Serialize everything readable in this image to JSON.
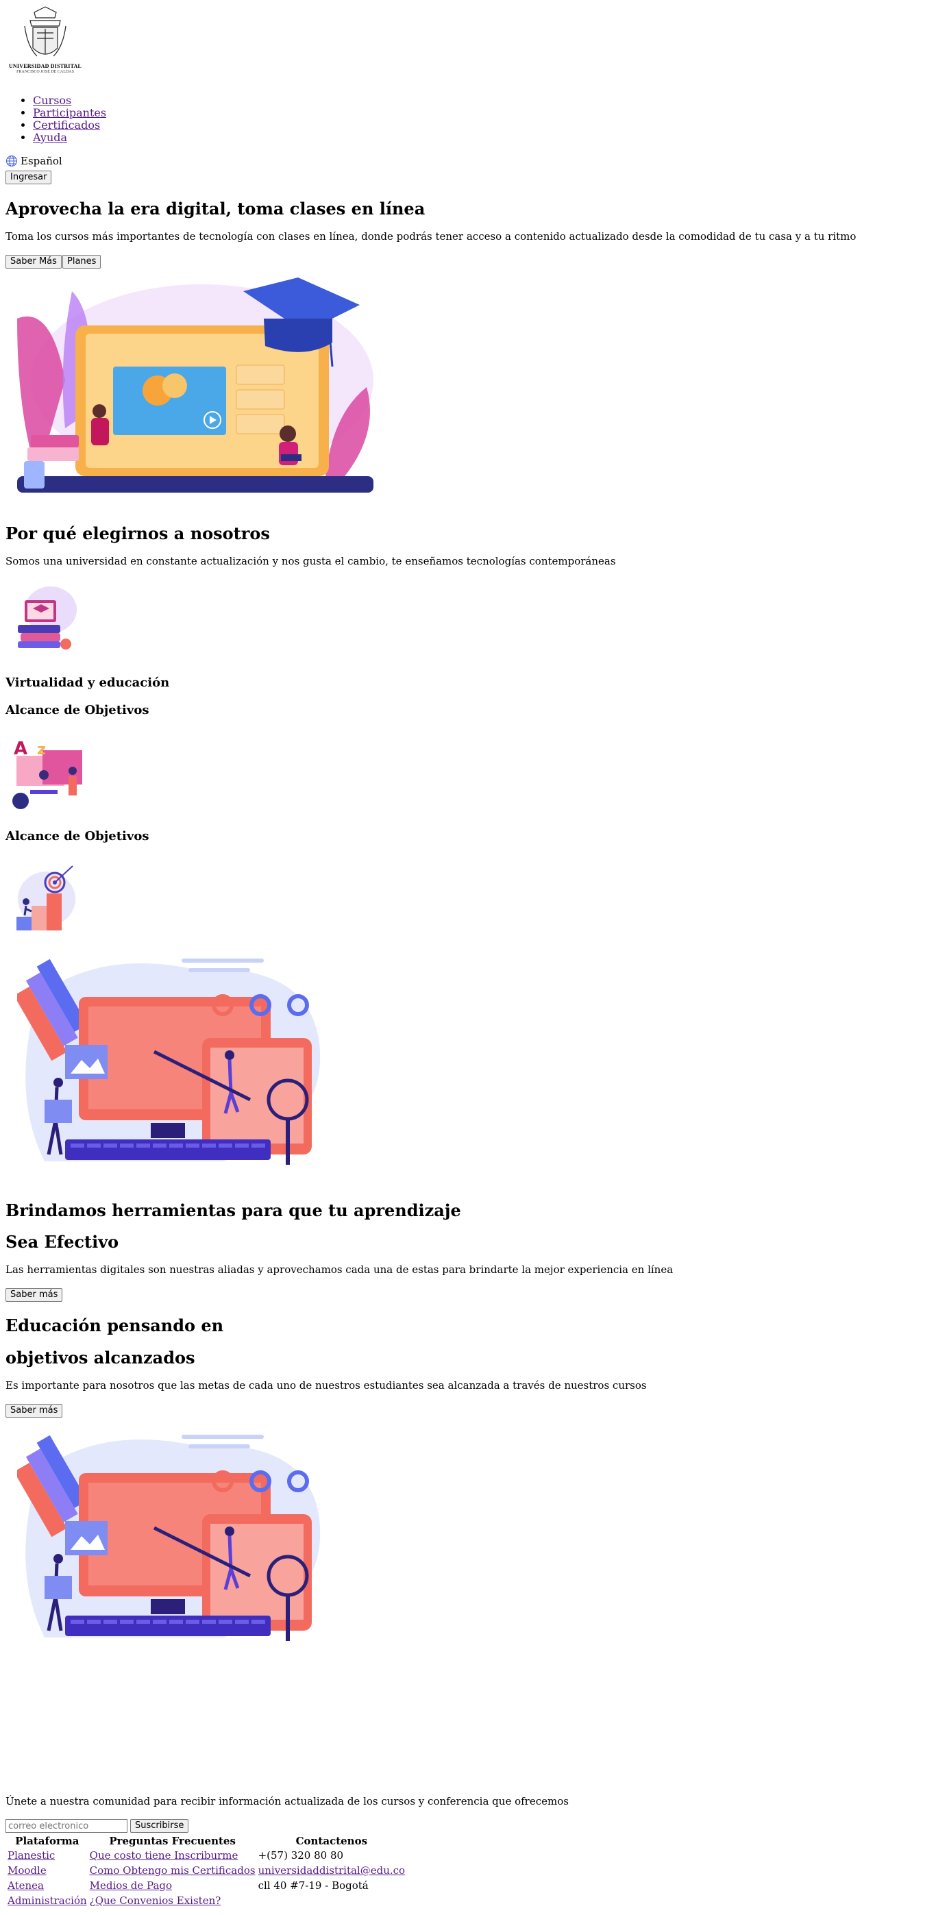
{
  "brand": {
    "logo_line1": "UNIVERSIDAD DISTRITAL",
    "logo_line2": "FRANCISCO JOSÉ DE CALDAS"
  },
  "nav": {
    "items": [
      {
        "label": "Cursos"
      },
      {
        "label": "Participantes"
      },
      {
        "label": "Certificados"
      },
      {
        "label": "Ayuda"
      }
    ],
    "language": "Español",
    "language_icon": "globe-icon",
    "login_label": "Ingresar"
  },
  "hero": {
    "title": "Aprovecha la era digital, toma clases en línea",
    "subtitle": "Toma los cursos más importantes de tecnología con clases en línea, donde podrás tener acceso a contenido actualizado desde la comodidad de tu casa y a tu ritmo",
    "btn_more": "Saber Más",
    "btn_plans": "Planes"
  },
  "why": {
    "title": "Por qué elegirnos a nosotros",
    "text": "Somos una universidad en constante actualización y nos gusta el cambio, te enseñamos tecnologías contemporáneas",
    "features": [
      {
        "title": "Virtualidad y educación"
      },
      {
        "title": "Alcance de Objetivos"
      },
      {
        "title": "Alcance de Objetivos"
      }
    ]
  },
  "tools": {
    "title_line1": "Brindamos herramientas para que tu aprendizaje",
    "title_line2": "Sea Efectivo",
    "text": "Las herramientas digitales son nuestras aliadas y aprovechamos cada una de estas para brindarte la mejor experiencia en línea",
    "button": "Saber más"
  },
  "education": {
    "title_line1": "Educación pensando en",
    "title_line2": "objetivos alcanzados",
    "text": "Es importante para nosotros que las metas de cada uno de nuestros estudiantes sea alcanzada a través de nuestros cursos",
    "button": "Saber más"
  },
  "newsletter": {
    "text": "Únete a nuestra comunidad para recibir información actualizada de los cursos y conferencia que ofrecemos",
    "placeholder": "correo electronico",
    "button": "Suscribirse"
  },
  "footer": {
    "headers": [
      "Plataforma",
      "Preguntas Frecuentes",
      "Contactenos"
    ],
    "rows": [
      [
        "Planestic",
        "Que costo tiene Inscriburme",
        "+(57) 320 80 80"
      ],
      [
        "Moodle",
        "Como Obtengo mis Certificados",
        "universidaddistrital@edu.co"
      ],
      [
        "Atenea",
        "Medios de Pago",
        "cll 40 #7-19 - Bogotá"
      ],
      [
        "Administración",
        "¿Que Convenios Existen?",
        ""
      ]
    ]
  },
  "colors": {
    "link": "#551a8b",
    "illustration_purple": "#5b3fd6",
    "illustration_coral": "#f26b5e",
    "illustration_orange": "#f8b04a"
  }
}
